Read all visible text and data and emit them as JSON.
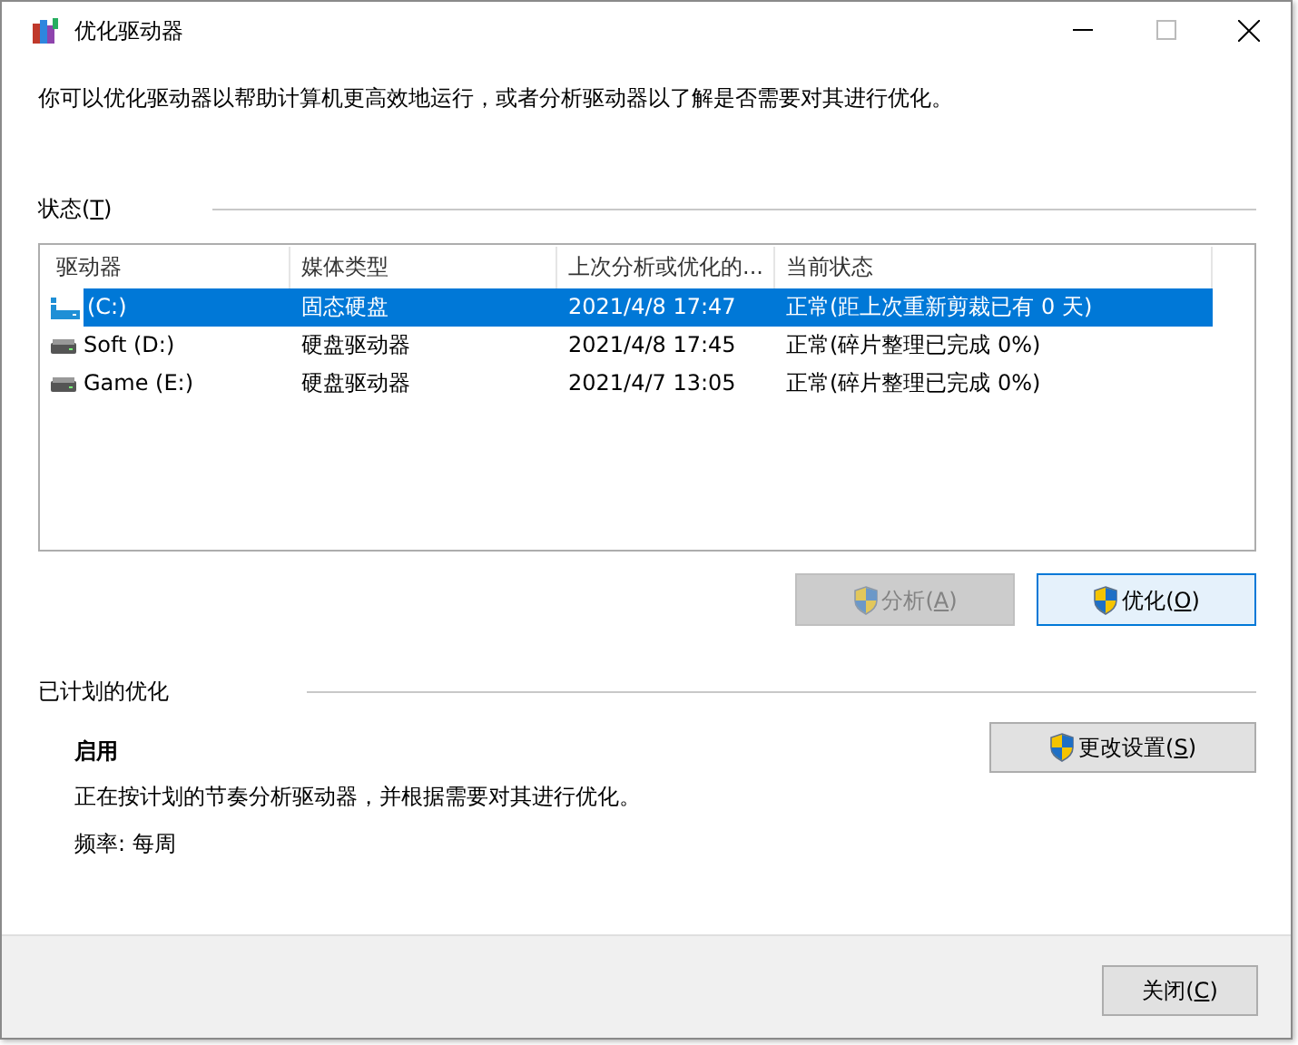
{
  "window": {
    "title": "优化驱动器"
  },
  "intro": "你可以优化驱动器以帮助计算机更高效地运行，或者分析驱动器以了解是否需要对其进行优化。",
  "status_section": {
    "label": {
      "pre": "状态(",
      "key": "T",
      "post": ")"
    }
  },
  "table": {
    "columns": [
      "驱动器",
      "媒体类型",
      "上次分析或优化的...",
      "当前状态"
    ],
    "rows": [
      {
        "kind": "ssd",
        "selected": true,
        "cells": [
          "(C:)",
          "固态硬盘",
          "2021/4/8 17:47",
          "正常(距上次重新剪裁已有 0 天)"
        ]
      },
      {
        "kind": "hdd",
        "selected": false,
        "cells": [
          "Soft (D:)",
          "硬盘驱动器",
          "2021/4/8 17:45",
          "正常(碎片整理已完成 0%)"
        ]
      },
      {
        "kind": "hdd",
        "selected": false,
        "cells": [
          "Game (E:)",
          "硬盘驱动器",
          "2021/4/7 13:05",
          "正常(碎片整理已完成 0%)"
        ]
      }
    ]
  },
  "actions": [
    {
      "pre": "分析(",
      "key": "A",
      "post": ")",
      "disabled": true,
      "focused": false
    },
    {
      "pre": "优化(",
      "key": "O",
      "post": ")",
      "disabled": false,
      "focused": true
    }
  ],
  "schedule": {
    "label": "已计划的优化",
    "state": "启用",
    "description": "正在按计划的节奏分析驱动器，并根据需要对其进行优化。",
    "frequency": "频率: 每周",
    "button": {
      "pre": "更改设置(",
      "key": "S",
      "post": ")"
    }
  },
  "footer": {
    "close_button": {
      "pre": "关闭(",
      "key": "C",
      "post": ")"
    }
  }
}
